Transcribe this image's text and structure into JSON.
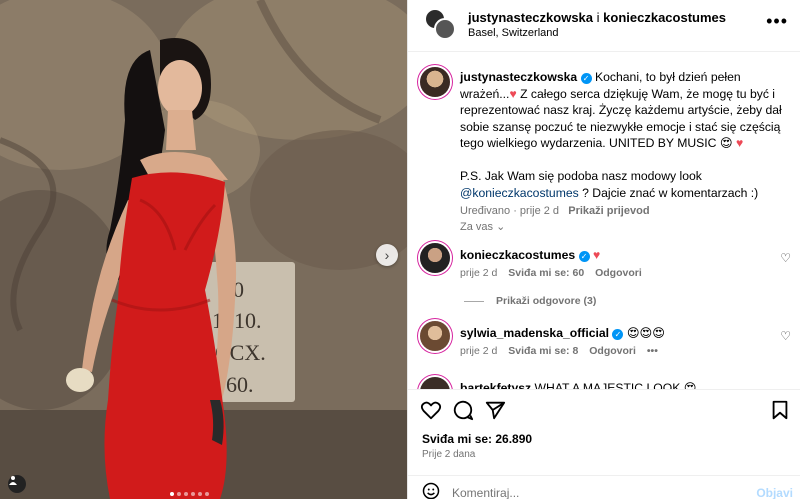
{
  "post": {
    "header": {
      "author1": "justynasteczkowska",
      "joiner": "i",
      "author2": "konieczkacostumes",
      "location": "Basel, Switzerland"
    },
    "caption": {
      "username": "justynasteczkowska",
      "text1": "Kochani, to był dzień pełen wrażeń...",
      "text2": " Z całego serca dziękuję Wam, że mogę tu być i reprezentować nasz kraj. Życzę każdemu artyście, żeby dał sobie szansę poczuć te niezwykłe emocje i stać się częścią tego wielkiego wydarzenia. UNITED BY MUSIC ",
      "ps_text": "P.S. Jak Wam się podoba nasz modowy look ",
      "ps_mention": "@konieczkacostumes",
      "ps_text2": " ? Dajcie znać w komentarzach :)",
      "meta_edited": "Uređivano · prije 2 d",
      "meta_translate": "Prikaži prijevod"
    },
    "see_all": "Za vas ⌄",
    "comments": [
      {
        "username": "konieczkacostumes",
        "text": "",
        "age": "prije 2 d",
        "likes": "Sviđa mi se: 60",
        "reply": "Odgovori",
        "view_replies": "Prikaži odgovore (3)"
      },
      {
        "username": "sylwia_madenska_official",
        "text": "",
        "age": "prije 2 d",
        "likes": "Sviđa mi se: 8",
        "reply": "Odgovori",
        "more": "•••"
      },
      {
        "username": "bartekfetysz",
        "text": "WHAT A MAJESTIC LOOK"
      }
    ],
    "likes_total": "Sviđa mi se: 26.890",
    "date": "Prije 2 dana",
    "comment_placeholder": "Komentiraj...",
    "post_label": "Objavi"
  },
  "photo": {
    "stone_text": [
      "10",
      "1010.",
      "CCX.",
      "760."
    ]
  },
  "colors": {
    "accent": "#0095f6",
    "heart": "#ed4956",
    "dress": "#d11b1b"
  }
}
